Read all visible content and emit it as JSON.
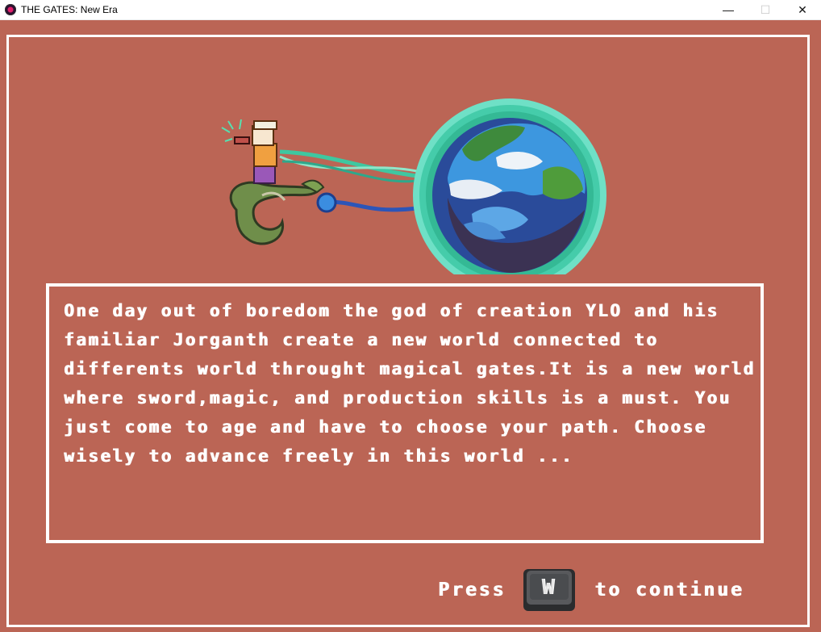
{
  "window": {
    "title": "THE GATES: New Era",
    "minimize_glyph": "—",
    "maximize_glyph": "☐",
    "close_glyph": "✕"
  },
  "story": {
    "text": "One day out of boredom the god of creation YLO and his familiar Jorganth create a new world connected to differents world throught magical gates.It is a new world where sword,magic, and production skills is a must. You just come to age and have to choose your path. Choose wisely to advance freely in this world ..."
  },
  "prompt": {
    "press": "Press",
    "key": "W",
    "continue": "to continue"
  },
  "colors": {
    "background": "#bb6555",
    "frame": "#ffffff",
    "text": "#ffffff",
    "orb_glow": "#5fd9bd",
    "key_body": "#4a4c4f"
  },
  "icons": {
    "app": "app-logo-icon",
    "character": "god-riding-dragon-sprite",
    "planet": "planet-orb-sprite",
    "key": "w-key-icon"
  }
}
